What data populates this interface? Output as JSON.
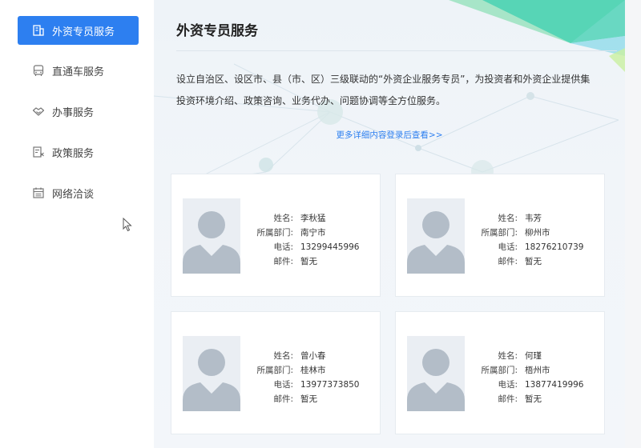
{
  "sidebar": {
    "items": [
      {
        "label": "外资专员服务",
        "icon": "building-icon",
        "active": true
      },
      {
        "label": "直通车服务",
        "icon": "bus-icon",
        "active": false
      },
      {
        "label": "办事服务",
        "icon": "handshake-icon",
        "active": false
      },
      {
        "label": "政策服务",
        "icon": "policy-doc-icon",
        "active": false
      },
      {
        "label": "网络洽谈",
        "icon": "calendar-icon",
        "active": false
      }
    ]
  },
  "main": {
    "title": "外资专员服务",
    "description_line1": "设立自治区、设区市、县（市、区）三级联动的“外资企业服务专员”，为投资者和外资企业提供集",
    "description_line2": "投资环境介绍、政策咨询、业务代办、问题协调等全方位服务。",
    "more_link": "更多详细内容登录后查看>>",
    "field_labels": {
      "name": "姓名:",
      "dept": "所属部门:",
      "phone": "电话:",
      "email": "邮件:"
    },
    "specialists": [
      {
        "name": "李秋猛",
        "dept": "南宁市",
        "phone": "13299445996",
        "email": "暂无"
      },
      {
        "name": "韦芳",
        "dept": "柳州市",
        "phone": "18276210739",
        "email": "暂无"
      },
      {
        "name": "曾小春",
        "dept": "桂林市",
        "phone": "13977373850",
        "email": "暂无"
      },
      {
        "name": "何瑾",
        "dept": "梧州市",
        "phone": "13877419996",
        "email": "暂无"
      }
    ]
  },
  "colors": {
    "accent": "#2d7ff0",
    "teal": "#3ccfb0",
    "green": "#7ed957"
  }
}
